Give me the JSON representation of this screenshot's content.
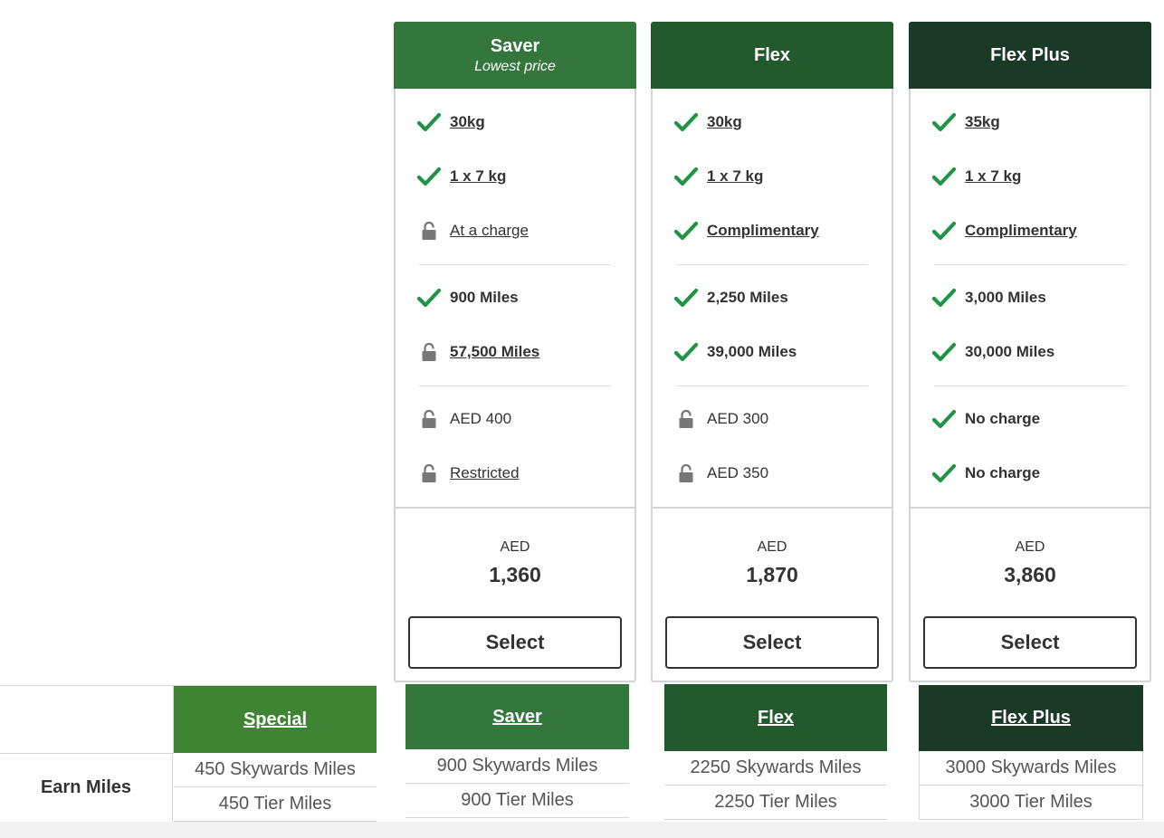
{
  "colors": {
    "saver": "#33773d",
    "flex": "#225a2e",
    "flex_plus": "#1a3a27",
    "special": "#3f8433",
    "check": "#1e9444",
    "lock": "#777777"
  },
  "fares": [
    {
      "name": "Saver",
      "subtitle": "Lowest price",
      "features": [
        {
          "icon": "check-icon",
          "text": "30kg",
          "bold": true,
          "link": true
        },
        {
          "icon": "check-icon",
          "text": "1 x 7 kg",
          "bold": true,
          "link": true
        },
        {
          "icon": "lock-icon",
          "text": "At a charge",
          "bold": false,
          "link": true
        },
        {
          "icon": "check-icon",
          "text": "900 Miles",
          "bold": true,
          "link": false
        },
        {
          "icon": "lock-icon",
          "text": "57,500 Miles",
          "bold": true,
          "link": true
        },
        {
          "icon": "lock-icon",
          "text": "AED 400",
          "bold": false,
          "link": false
        },
        {
          "icon": "lock-icon",
          "text": "Restricted",
          "bold": false,
          "link": true
        }
      ],
      "currency": "AED",
      "price": "1,360",
      "select_label": "Select"
    },
    {
      "name": "Flex",
      "subtitle": "",
      "features": [
        {
          "icon": "check-icon",
          "text": "30kg",
          "bold": true,
          "link": true
        },
        {
          "icon": "check-icon",
          "text": "1 x 7 kg",
          "bold": true,
          "link": true
        },
        {
          "icon": "check-icon",
          "text": "Complimentary",
          "bold": true,
          "link": true
        },
        {
          "icon": "check-icon",
          "text": "2,250 Miles",
          "bold": true,
          "link": false
        },
        {
          "icon": "check-icon",
          "text": "39,000 Miles",
          "bold": true,
          "link": false
        },
        {
          "icon": "lock-icon",
          "text": "AED 300",
          "bold": false,
          "link": false
        },
        {
          "icon": "lock-icon",
          "text": "AED 350",
          "bold": false,
          "link": false
        }
      ],
      "currency": "AED",
      "price": "1,870",
      "select_label": "Select"
    },
    {
      "name": "Flex Plus",
      "subtitle": "",
      "features": [
        {
          "icon": "check-icon",
          "text": "35kg",
          "bold": true,
          "link": true
        },
        {
          "icon": "check-icon",
          "text": "1 x 7 kg",
          "bold": true,
          "link": true
        },
        {
          "icon": "check-icon",
          "text": "Complimentary",
          "bold": true,
          "link": true
        },
        {
          "icon": "check-icon",
          "text": "3,000 Miles",
          "bold": true,
          "link": false
        },
        {
          "icon": "check-icon",
          "text": "30,000 Miles",
          "bold": true,
          "link": false
        },
        {
          "icon": "check-icon",
          "text": "No charge",
          "bold": true,
          "link": false
        },
        {
          "icon": "check-icon",
          "text": "No charge",
          "bold": true,
          "link": false
        }
      ],
      "currency": "AED",
      "price": "3,860",
      "select_label": "Select"
    }
  ],
  "miles_table": {
    "row_label": "Earn Miles",
    "columns": [
      {
        "name": "Special",
        "skywards": "450 Skywards Miles",
        "tier": "450 Tier Miles"
      },
      {
        "name": "Saver",
        "skywards": "900 Skywards Miles",
        "tier": "900 Tier Miles"
      },
      {
        "name": "Flex",
        "skywards": "2250 Skywards Miles",
        "tier": "2250 Tier Miles"
      },
      {
        "name": "Flex Plus",
        "skywards": "3000 Skywards Miles",
        "tier": "3000 Tier Miles"
      }
    ]
  }
}
